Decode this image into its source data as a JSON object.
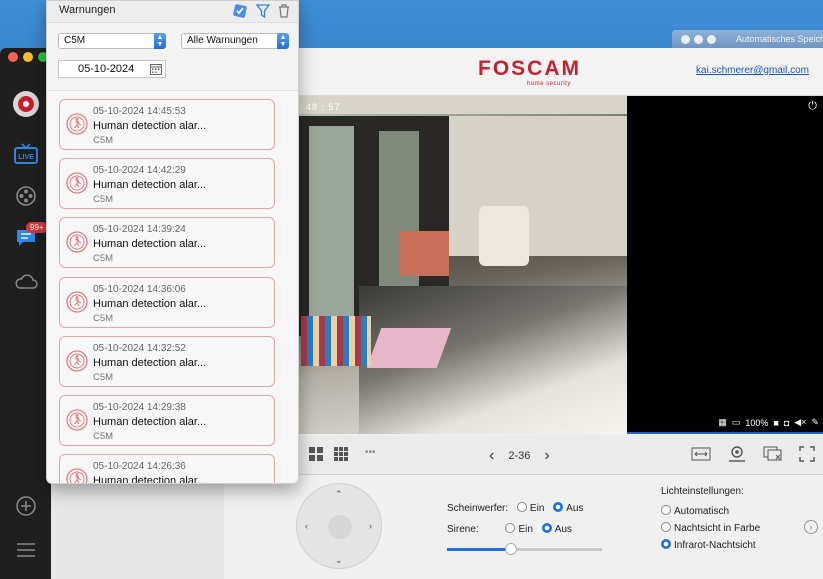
{
  "background_window": {
    "title": "Automatisches Speich"
  },
  "app": {
    "logo": "FOSCAM",
    "logo_sub": "home security",
    "user_email": "kai.schmerer@gmail.com",
    "alert_badge": "99+"
  },
  "popover": {
    "title": "Warnungen",
    "camera_select": "C5M",
    "type_select": "Alle Warnungen",
    "date": "05-10-2024",
    "alerts": [
      {
        "time": "05-10-2024 14:45:53",
        "message": "Human detection alar...",
        "camera": "C5M"
      },
      {
        "time": "05-10-2024 14:42:29",
        "message": "Human detection alar...",
        "camera": "C5M"
      },
      {
        "time": "05-10-2024 14:39:24",
        "message": "Human detection alar...",
        "camera": "C5M"
      },
      {
        "time": "05-10-2024 14:36:06",
        "message": "Human detection alar...",
        "camera": "C5M"
      },
      {
        "time": "05-10-2024 14:32:52",
        "message": "Human detection alar...",
        "camera": "C5M"
      },
      {
        "time": "05-10-2024 14:29:38",
        "message": "Human detection alar...",
        "camera": "C5M"
      },
      {
        "time": "05-10-2024 14:26:36",
        "message": "Human detection alar...",
        "camera": "C5M"
      }
    ]
  },
  "video": {
    "timecode": ": 48 : 57",
    "battery": "100%"
  },
  "controls": {
    "pager_label": "2-36",
    "more": "•••"
  },
  "settings": {
    "spotlight_label": "Scheinwerfer:",
    "siren_label": "Sirene:",
    "on_label": "Ein",
    "off_label": "Aus",
    "spotlight_value": "Aus",
    "siren_value": "Aus",
    "light_settings_label": "Lichteinstellungen:",
    "light_options": [
      "Automatisch",
      "Nachtsicht in Farbe",
      "Infrarot-Nachtsicht"
    ],
    "light_selected": "Infrarot-Nachtsicht",
    "volume_level": 0.41
  },
  "colors": {
    "brand_red": "#c7202e",
    "accent_blue": "#1e73e0",
    "alert_border": "#e6a5a8"
  }
}
